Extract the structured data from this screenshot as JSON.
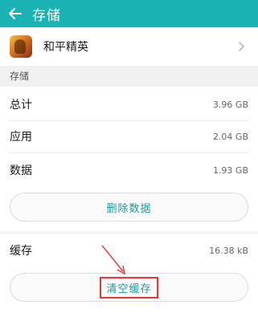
{
  "header": {
    "title": "存储",
    "back_icon": "back-arrow-icon"
  },
  "app": {
    "name": "和平精英",
    "icon": "game-app-icon",
    "chevron": "chevron-right-icon"
  },
  "storage": {
    "section_label": "存储",
    "rows": [
      {
        "label": "总计",
        "value": "3.96 GB"
      },
      {
        "label": "应用",
        "value": "2.04 GB"
      },
      {
        "label": "数据",
        "value": "1.93 GB"
      }
    ],
    "clear_data_label": "删除数据"
  },
  "cache": {
    "label": "缓存",
    "value": "16.38 kB",
    "clear_cache_label": "清空缓存"
  },
  "colors": {
    "appbar": "#1bb2b3",
    "accent_text": "#1a9aa0",
    "annotation": "#e53935"
  }
}
